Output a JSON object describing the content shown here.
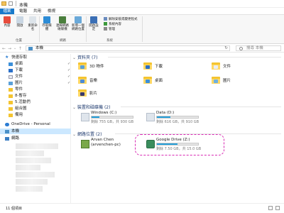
{
  "window": {
    "title": "本機"
  },
  "tabs": [
    "檔案",
    "電腦",
    "共用",
    "檢視"
  ],
  "ribbon": {
    "buttons": [
      "內容",
      "開啟",
      "重新命名",
      "存取媒體",
      "連線網路磁碟機",
      "新增一個網路位置",
      "開啟設定"
    ],
    "groups": [
      "位置",
      "網路",
      "系統"
    ],
    "system_items": [
      "解除安裝或變更程式",
      "系統內容",
      "管理"
    ]
  },
  "address": {
    "path": "本機",
    "search_placeholder": "搜尋 本機"
  },
  "sidebar": {
    "quick_access": "快速存取",
    "items": [
      {
        "label": "桌面",
        "pinned": true
      },
      {
        "label": "下載",
        "pinned": true
      },
      {
        "label": "文件",
        "pinned": true
      },
      {
        "label": "圖片",
        "pinned": true
      },
      {
        "label": "零件"
      },
      {
        "label": "8-暫存"
      },
      {
        "label": "5.活動們"
      },
      {
        "label": "組合圖"
      },
      {
        "label": "備用"
      }
    ],
    "onedrive": "OneDrive - Personal",
    "thispc": "本機",
    "network": "網路"
  },
  "main": {
    "folders_header": "資料夾 (7)",
    "folders": [
      "3D 物件",
      "下載",
      "文件",
      "音樂",
      "桌面",
      "圖片",
      "影片"
    ],
    "drives_header": "裝置和磁碟機 (2)",
    "drives": [
      {
        "name": "Windows (C:)",
        "space": "剩餘 755 GB，共 930 GB",
        "used_fraction": 0.19
      },
      {
        "name": "Data (D:)",
        "space": "剩餘 616 GB，共 910 GB",
        "used_fraction": 0.32
      }
    ],
    "network_header": "網路位置 (2)",
    "network": [
      {
        "name": "Arvan Chen",
        "sub": "(arvenchen-pc)"
      },
      {
        "name": "Google Drive (Z:)",
        "space": "剩餘 7.50 GB，共 15.0 GB",
        "used_fraction": 0.5
      }
    ]
  },
  "status": {
    "count": "11 個項目"
  },
  "colors": {
    "accent": "#1979ca",
    "bar": "#26a0da",
    "highlight": "#d92bb4"
  }
}
